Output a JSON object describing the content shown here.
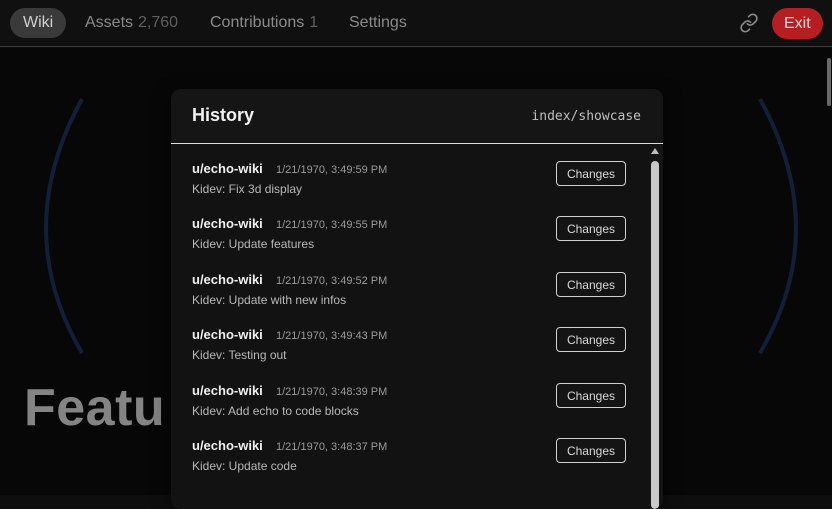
{
  "nav": {
    "wiki": "Wiki",
    "assets": "Assets",
    "assets_count": "2,760",
    "contributions": "Contributions",
    "contributions_count": "1",
    "settings": "Settings",
    "exit": "Exit",
    "link_icon": "link-icon"
  },
  "background": {
    "heading": "Featu"
  },
  "modal": {
    "title": "History",
    "path": "index/showcase",
    "changes_label": "Changes",
    "entries": [
      {
        "user": "u/echo-wiki",
        "time": "1/21/1970, 3:49:59 PM",
        "message": "Kidev: Fix 3d display"
      },
      {
        "user": "u/echo-wiki",
        "time": "1/21/1970, 3:49:55 PM",
        "message": "Kidev: Update features"
      },
      {
        "user": "u/echo-wiki",
        "time": "1/21/1970, 3:49:52 PM",
        "message": "Kidev: Update with new infos"
      },
      {
        "user": "u/echo-wiki",
        "time": "1/21/1970, 3:49:43 PM",
        "message": "Kidev: Testing out"
      },
      {
        "user": "u/echo-wiki",
        "time": "1/21/1970, 3:48:39 PM",
        "message": "Kidev: Add echo to code blocks"
      },
      {
        "user": "u/echo-wiki",
        "time": "1/21/1970, 3:48:37 PM",
        "message": "Kidev: Update code"
      }
    ]
  },
  "colors": {
    "exit_bg": "#b51f24",
    "accent_blue": "#1f3a66"
  }
}
